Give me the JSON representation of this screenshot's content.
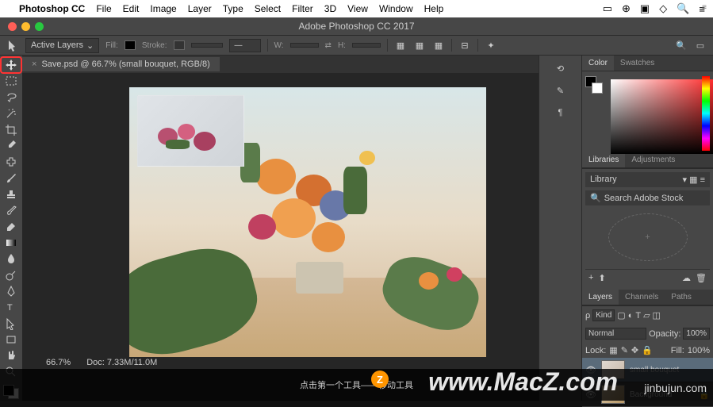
{
  "menubar": {
    "app": "Photoshop CC",
    "items": [
      "File",
      "Edit",
      "Image",
      "Layer",
      "Type",
      "Select",
      "Filter",
      "3D",
      "View",
      "Window",
      "Help"
    ]
  },
  "window": {
    "title": "Adobe Photoshop CC 2017"
  },
  "options": {
    "select_label": "Active Layers",
    "fill_label": "Fill:",
    "stroke_label": "Stroke:",
    "w_label": "W:",
    "h_label": "H:"
  },
  "document": {
    "tab": "Save.psd @ 66.7% (small bouquet, RGB/8)"
  },
  "panels": {
    "color_tab": "Color",
    "swatches_tab": "Swatches",
    "libraries_tab": "Libraries",
    "adjustments_tab": "Adjustments",
    "library_dropdown": "Library",
    "search_placeholder": "Search Adobe Stock",
    "layers_tab": "Layers",
    "channels_tab": "Channels",
    "paths_tab": "Paths",
    "kind_label": "Kind",
    "blend_mode": "Normal",
    "opacity_label": "Opacity:",
    "opacity_value": "100%",
    "lock_label": "Lock:",
    "fill_label": "Fill:",
    "fill_value": "100%"
  },
  "layers": [
    {
      "name": "small bouquet",
      "selected": true
    },
    {
      "name": "Background",
      "selected": false
    }
  ],
  "status": {
    "zoom": "66.7%",
    "docinfo": "Doc: 7.33M/11.0M"
  },
  "caption": "点击第一个工具——移动工具",
  "watermark1": "www.MacZ.com",
  "watermark2": "jinbujun.com",
  "badge": "Z"
}
